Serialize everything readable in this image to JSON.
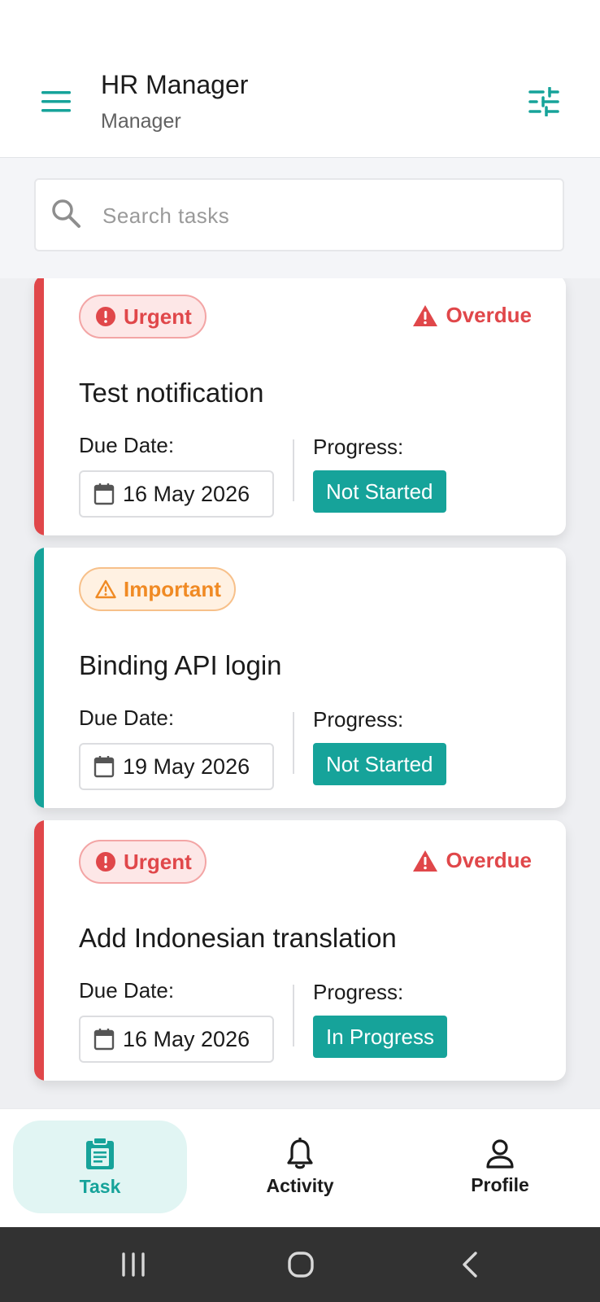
{
  "header": {
    "title": "HR Manager",
    "subtitle": "Manager"
  },
  "search": {
    "placeholder": "Search tasks"
  },
  "tasks": [
    {
      "priority": "Urgent",
      "priority_level": "urgent",
      "status_flag": "Overdue",
      "title": "Test notification",
      "due_label": "Due Date:",
      "due_date": "16 May 2026",
      "progress_label": "Progress:",
      "progress": "Not Started"
    },
    {
      "priority": "Important",
      "priority_level": "important",
      "status_flag": "",
      "title": "Binding API login",
      "due_label": "Due Date:",
      "due_date": "19 May 2026",
      "progress_label": "Progress:",
      "progress": "Not Started"
    },
    {
      "priority": "Urgent",
      "priority_level": "urgent",
      "status_flag": "Overdue",
      "title": "Add Indonesian translation",
      "due_label": "Due Date:",
      "due_date": "16 May 2026",
      "progress_label": "Progress:",
      "progress": "In Progress"
    }
  ],
  "bottom_nav": {
    "items": [
      {
        "label": "Task",
        "icon": "clipboard-icon",
        "active": true
      },
      {
        "label": "Activity",
        "icon": "bell-icon",
        "active": false
      },
      {
        "label": "Profile",
        "icon": "person-icon",
        "active": false
      }
    ]
  },
  "colors": {
    "accent": "#16a39a",
    "urgent": "#e0474a",
    "important": "#f08a24"
  }
}
